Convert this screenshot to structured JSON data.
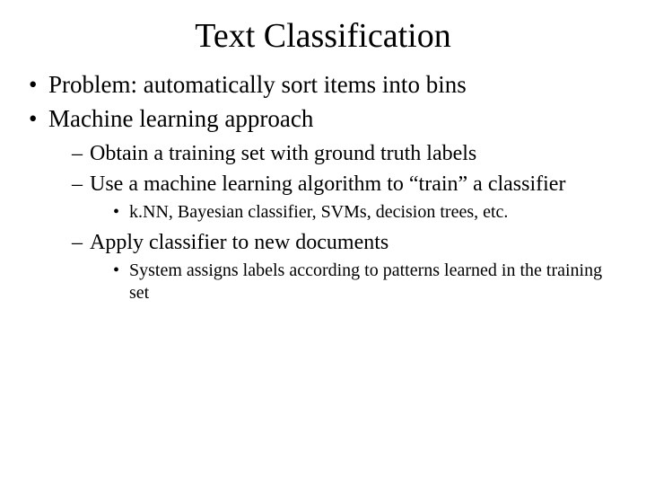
{
  "title": "Text Classification",
  "bullets": {
    "b1": "Problem: automatically sort items into bins",
    "b2": "Machine learning approach",
    "b2_sub": {
      "s1": "Obtain a training set with ground truth labels",
      "s2": "Use a machine learning algorithm to “train” a classifier",
      "s2_sub": {
        "t1": "k.NN, Bayesian classifier, SVMs, decision trees, etc."
      },
      "s3": "Apply classifier to new documents",
      "s3_sub": {
        "t1": "System assigns labels according to patterns learned in the training set"
      }
    }
  }
}
